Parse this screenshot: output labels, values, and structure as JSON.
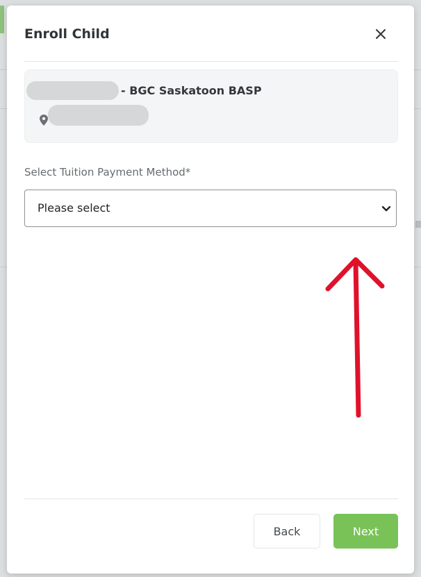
{
  "modal": {
    "title": "Enroll Child",
    "close_icon": "close-icon"
  },
  "program": {
    "name": "- BGC Saskatoon BASP",
    "location_icon": "map-pin-icon"
  },
  "tuition": {
    "label": "Select Tuition Payment Method*",
    "selected": "Please select",
    "chevron_icon": "chevron-down-icon"
  },
  "footer": {
    "back_label": "Back",
    "next_label": "Next"
  },
  "colors": {
    "primary": "#78c257",
    "annotation_arrow": "#e0112b"
  }
}
